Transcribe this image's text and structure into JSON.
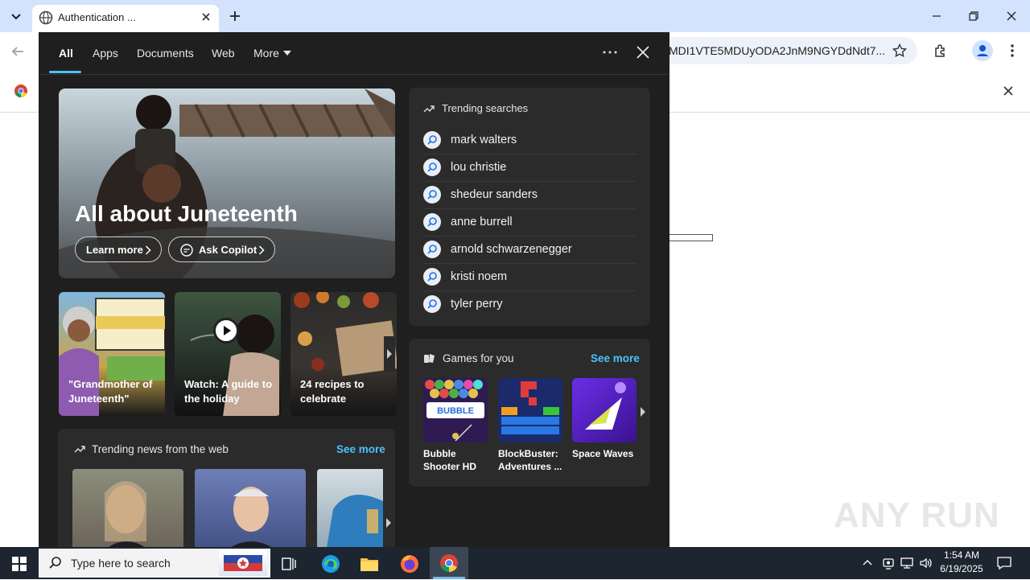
{
  "browser": {
    "tab_title": "Authentication ...",
    "address_text": "MDI1VTE5MDUyODA2JnM9NGYDdNdt7...",
    "colors": {
      "tabstrip": "#d3e3fd",
      "omnibox": "#edf2fa"
    }
  },
  "flyout": {
    "nav": [
      "All",
      "Apps",
      "Documents",
      "Web",
      "More"
    ],
    "hero": {
      "title": "All about Juneteenth",
      "learn_more": "Learn more",
      "ask_copilot": "Ask Copilot"
    },
    "tiles": [
      {
        "caption": "\"Grandmother of Juneteenth\""
      },
      {
        "caption": "Watch: A guide to the holiday"
      },
      {
        "caption": "24 recipes to celebrate"
      }
    ],
    "trending": {
      "heading": "Trending searches",
      "items": [
        "mark walters",
        "lou christie",
        "shedeur sanders",
        "anne burrell",
        "arnold schwarzenegger",
        "kristi noem",
        "tyler perry"
      ]
    },
    "games": {
      "heading": "Games for you",
      "see_more": "See more",
      "items": [
        "Bubble Shooter HD",
        "BlockBuster: Adventures ...",
        "Space Waves"
      ]
    },
    "news": {
      "heading": "Trending news from the web",
      "see_more": "See more"
    },
    "colors": {
      "bg": "#1f1f1f",
      "card": "#2b2b2b",
      "accent": "#4cc2ff"
    }
  },
  "taskbar": {
    "search_placeholder": "Type here to search",
    "time": "1:54 AM",
    "date": "6/19/2025"
  },
  "watermark": "ANY RUN"
}
